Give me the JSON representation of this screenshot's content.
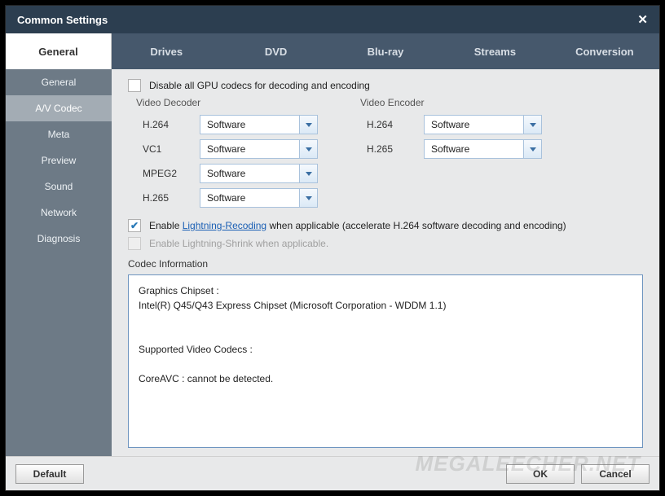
{
  "title": "Common Settings",
  "mainTab": "General",
  "tabs": [
    "Drives",
    "DVD",
    "Blu-ray",
    "Streams",
    "Conversion"
  ],
  "sidebar": [
    "General",
    "A/V Codec",
    "Meta",
    "Preview",
    "Sound",
    "Network",
    "Diagnosis"
  ],
  "disableGpu": "Disable all GPU codecs for decoding and encoding",
  "decoderHead": "Video Decoder",
  "encoderHead": "Video Encoder",
  "decoders": {
    "h264": {
      "label": "H.264",
      "value": "Software"
    },
    "vc1": {
      "label": "VC1",
      "value": "Software"
    },
    "mpeg2": {
      "label": "MPEG2",
      "value": "Software"
    },
    "h265": {
      "label": "H.265",
      "value": "Software"
    }
  },
  "encoders": {
    "h264": {
      "label": "H.264",
      "value": "Software"
    },
    "h265": {
      "label": "H.265",
      "value": "Software"
    }
  },
  "lightning": {
    "pre": "Enable ",
    "link": "Lightning-Recoding",
    "post": " when applicable (accelerate H.264 software decoding and encoding)"
  },
  "lightningShrink": "Enable Lightning-Shrink when applicable.",
  "codecInfoLabel": "Codec Information",
  "codecInfo": {
    "l1": "Graphics Chipset :",
    "l2": "Intel(R) Q45/Q43 Express Chipset (Microsoft Corporation - WDDM 1.1)",
    "l3": "Supported Video Codecs :",
    "l4": "CoreAVC : cannot be detected."
  },
  "buttons": {
    "default": "Default",
    "ok": "OK",
    "cancel": "Cancel"
  },
  "watermark": "MEGALEECHER.NET"
}
